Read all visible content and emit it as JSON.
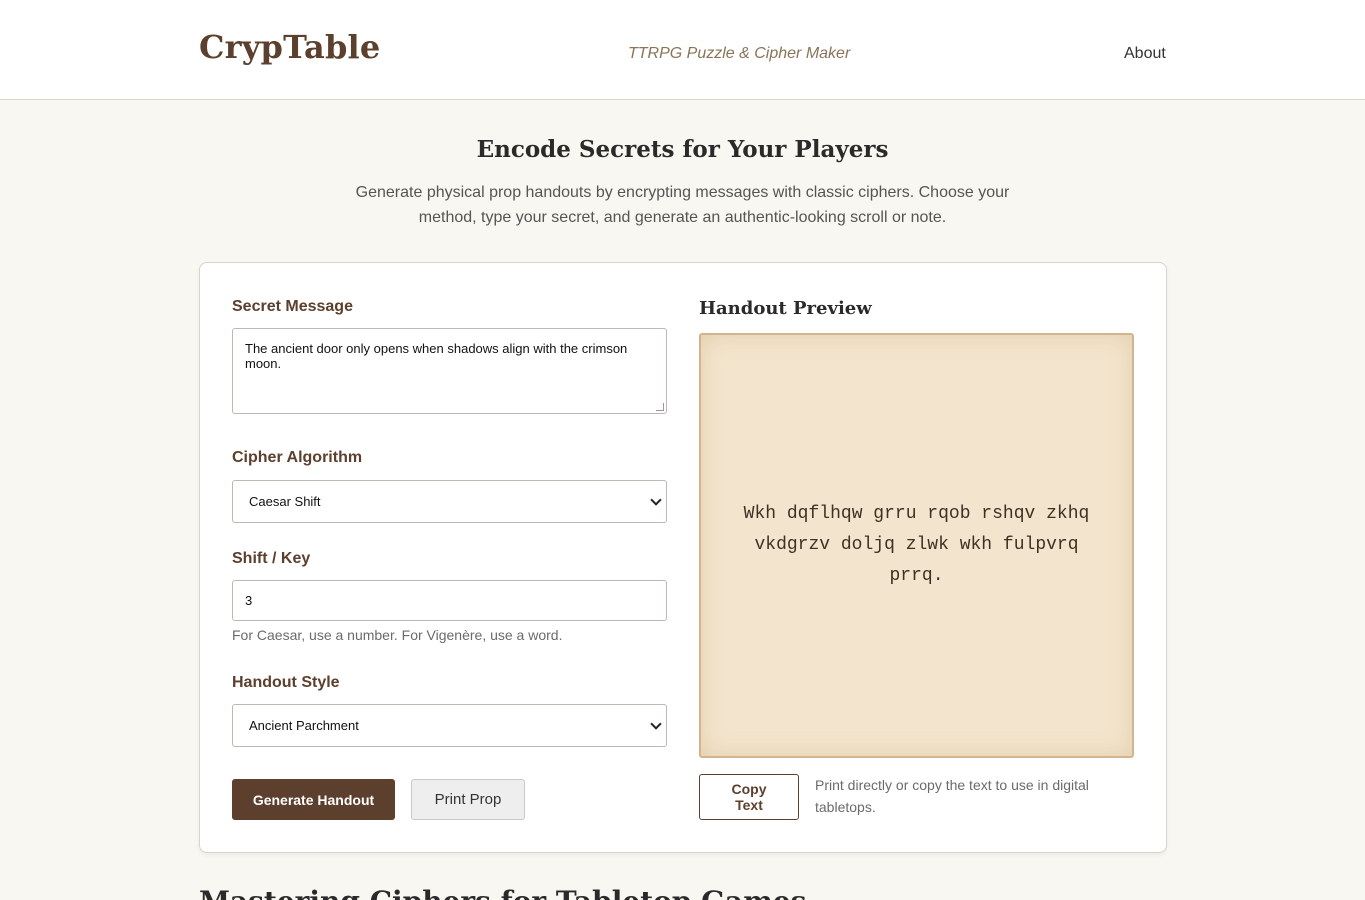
{
  "header": {
    "logo": "CrypTable",
    "tagline": "TTRPG Puzzle & Cipher Maker",
    "nav_about": "About"
  },
  "hero": {
    "title": "Encode Secrets for Your Players",
    "description": "Generate physical prop handouts by encrypting messages with classic ciphers. Choose your method, type your secret, and generate an authentic-looking scroll or note."
  },
  "form": {
    "message_label": "Secret Message",
    "message_value": "The ancient door only opens when shadows align with the crimson moon.",
    "cipher_label": "Cipher Algorithm",
    "cipher_value": "Caesar Shift",
    "key_label": "Shift / Key",
    "key_value": "3",
    "key_hint": "For Caesar, use a number. For Vigenère, use a word.",
    "style_label": "Handout Style",
    "style_value": "Ancient Parchment",
    "generate_button": "Generate Handout",
    "print_button": "Print Prop"
  },
  "preview": {
    "title": "Handout Preview",
    "cipher_text": "Wkh dqflhqw grru rqob rshqv zkhq vkdgrzv doljq zlwk wkh fulpvrq prrq.",
    "copy_button": "Copy Text",
    "copy_note": "Print directly or copy the text to use in digital tabletops."
  },
  "next_section": {
    "title": "Mastering Ciphers for Tabletop Games"
  },
  "colors": {
    "brand": "#5d3f2d",
    "parchment": "#f3e5cd",
    "background": "#f8f7f1"
  }
}
